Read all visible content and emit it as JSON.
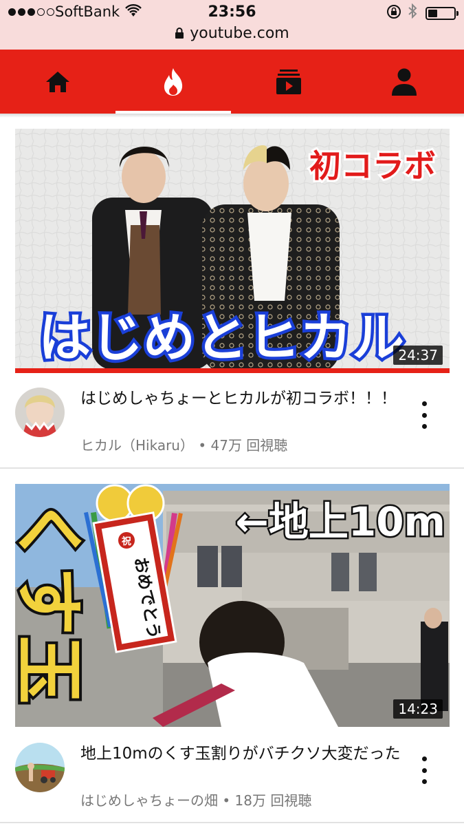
{
  "status_bar": {
    "carrier": "SoftBank",
    "time": "23:56",
    "battery_level": 0.35,
    "signal_bars": 3
  },
  "browser": {
    "url": "youtube.com"
  },
  "nav": {
    "accent_color": "#e62117",
    "tabs": [
      {
        "icon": "home-icon"
      },
      {
        "icon": "trending-icon",
        "active": true
      },
      {
        "icon": "subscriptions-icon"
      },
      {
        "icon": "account-icon"
      }
    ]
  },
  "videos": [
    {
      "title": "はじめしゃちょーとヒカルが初コラボ！！！",
      "channel": "ヒカル（Hikaru）",
      "views": "47万 回視聴",
      "duration": "24:37",
      "thumb_caption": "はじめとヒカル",
      "thumb_tag": "初コラボ"
    },
    {
      "title": "地上10mのくす玉割りがバチクソ大変だった",
      "channel": "はじめしゃちょーの畑",
      "views": "18万 回視聴",
      "duration": "14:23",
      "thumb_side_text": "くす玉",
      "thumb_banner": "←地上10m",
      "thumb_scroll": "おめでとう",
      "thumb_seal": "祝"
    }
  ]
}
